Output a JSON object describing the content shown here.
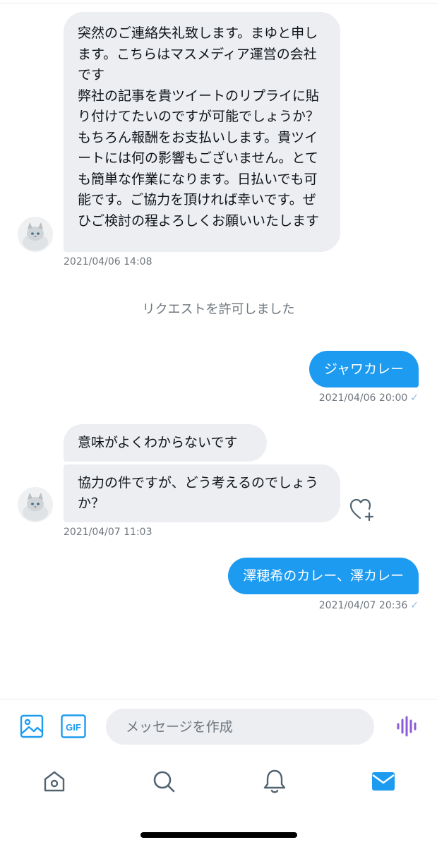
{
  "messages": {
    "incoming_1": {
      "text": "突然のご連絡失礼致します。まゆと申します。こちらはマスメディア運営の会社です\n弊社の記事を貴ツイートのリプライに貼り付けてたいのですが可能でしょうか？もちろん報酬をお支払いします。貴ツイートには何の影響もございません。とても簡単な作業になります。日払いでも可能です。ご協力を頂ければ幸いです。ぜひご検討の程よろしくお願いいたします",
      "timestamp": "2021/04/06 14:08"
    },
    "system_note": "リクエストを許可しました",
    "outgoing_1": {
      "text": "ジャワカレー",
      "timestamp": "2021/04/06 20:00",
      "read_mark": "✓"
    },
    "incoming_2a": {
      "text": "意味がよくわからないです"
    },
    "incoming_2b": {
      "text": "協力の件ですが、どう考えるのでしょうか？",
      "timestamp": "2021/04/07 11:03"
    },
    "outgoing_2": {
      "text": "澤穂希のカレー、澤カレー",
      "timestamp": "2021/04/07 20:36",
      "read_mark": "✓"
    }
  },
  "composer": {
    "placeholder": "メッセージを作成",
    "gif_label": "GIF"
  },
  "colors": {
    "accent": "#1d9bf0",
    "bubble_incoming": "#eceef1",
    "voice_purple": "#8a5cd8"
  },
  "icons": {
    "image": "image-icon",
    "gif": "gif-icon",
    "voice": "voice-icon",
    "home": "home-icon",
    "search": "search-icon",
    "notifications": "bell-icon",
    "messages": "mail-icon",
    "react": "heart-plus-icon"
  }
}
